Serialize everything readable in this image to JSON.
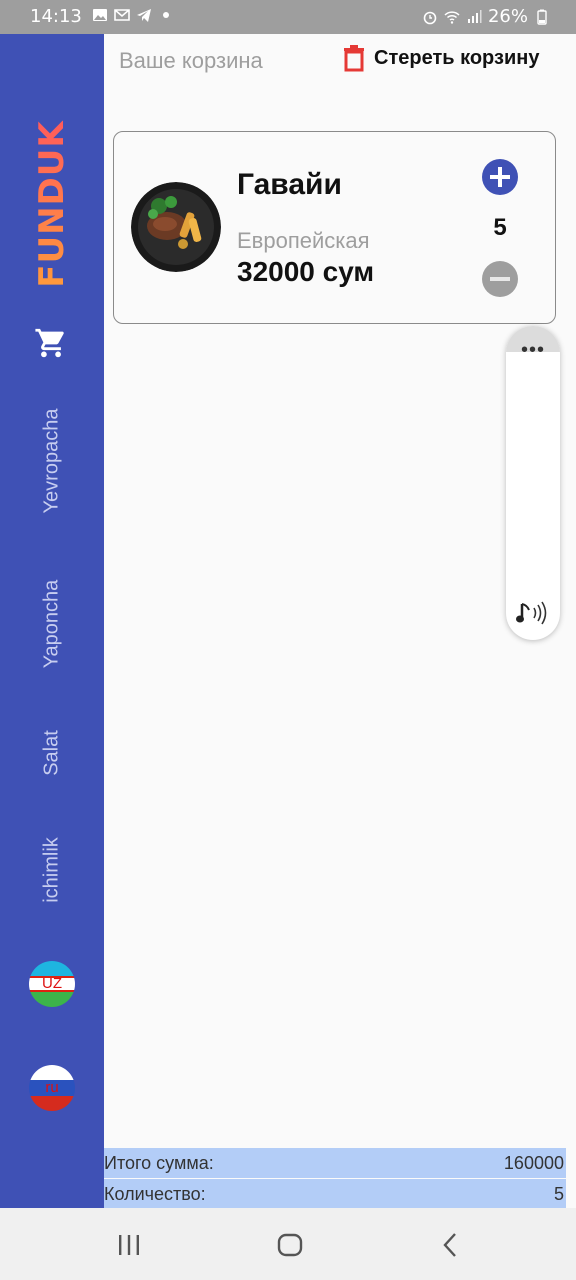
{
  "status_bar": {
    "time": "14:13",
    "battery": "26%"
  },
  "sidebar": {
    "brand": "FUNDUK",
    "categories": [
      {
        "label": "Yevropacha"
      },
      {
        "label": "Yaponcha"
      },
      {
        "label": "Salat"
      },
      {
        "label": "ichimlik"
      }
    ],
    "languages": [
      {
        "code": "UZ"
      },
      {
        "code": "ru"
      }
    ]
  },
  "header": {
    "title": "Ваше корзина",
    "clear_label": "Стереть корзину"
  },
  "cart": {
    "items": [
      {
        "name": "Гавайи",
        "category": "Европейская",
        "price": "32000 сум",
        "quantity": "5"
      }
    ]
  },
  "summary": {
    "total_label": "Итого сумма:",
    "total_value": "160000",
    "count_label": "Количество:",
    "count_value": "5"
  },
  "colors": {
    "sidebar": "#3f51b5",
    "accent": "#3f51b5",
    "delete": "#e53935",
    "totals_bg": "#b3cdf7"
  }
}
